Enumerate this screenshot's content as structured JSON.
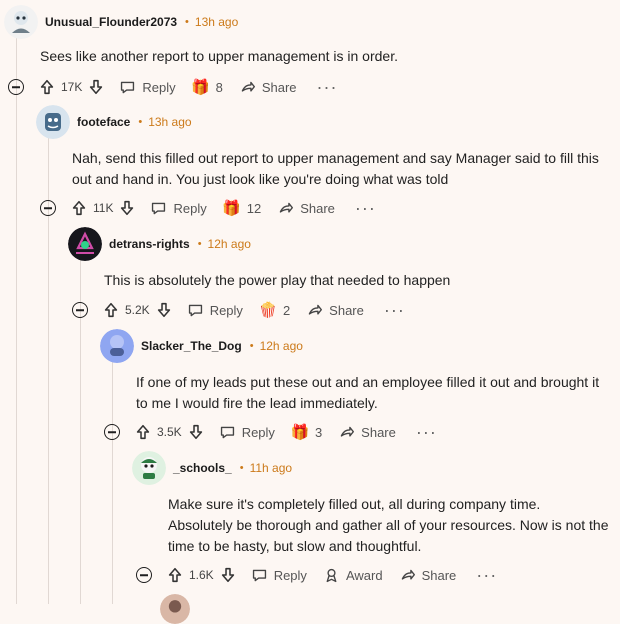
{
  "comments": [
    {
      "username": "Unusual_Flounder2073",
      "time": "13h ago",
      "dot": "•",
      "text": [
        "Sees like another report to upper management is in order."
      ],
      "votes": "17K",
      "reply": "Reply",
      "award_count": "8",
      "share": "Share",
      "more": "···",
      "award_icon": "🎁",
      "avatar_bg": "#f3f3f3",
      "avatar_fg": "#6f7f8a"
    },
    {
      "username": "footeface",
      "time": "13h ago",
      "dot": "•",
      "text": [
        "Nah, send this filled out report to upper management and say Manager said to fill this",
        "out and hand in. You just look like you're doing what was told"
      ],
      "votes": "11K",
      "reply": "Reply",
      "award_count": "12",
      "share": "Share",
      "more": "···",
      "award_icon": "🎁",
      "avatar_bg": "#dbe7ef",
      "avatar_fg": "#476b8a"
    },
    {
      "username": "detrans-rights",
      "time": "12h ago",
      "dot": "•",
      "text": [
        "This is absolutely the power play that needed to happen"
      ],
      "votes": "5.2K",
      "reply": "Reply",
      "award_count": "2",
      "share": "Share",
      "more": "···",
      "award_icon": "🍿",
      "avatar_bg": "#16161c",
      "avatar_fg": "#d04ca8"
    },
    {
      "username": "Slacker_The_Dog",
      "time": "12h ago",
      "dot": "•",
      "text": [
        "If one of my leads put these out and an employee filled it out and brought it",
        "to me I would fire the lead immediately."
      ],
      "votes": "3.5K",
      "reply": "Reply",
      "award_count": "3",
      "share": "Share",
      "more": "···",
      "award_icon": "🎁",
      "avatar_bg": "#8fa6f1",
      "avatar_fg": "#4b5f98"
    },
    {
      "username": "_schools_",
      "time": "11h ago",
      "dot": "•",
      "text": [
        "Make sure it's completely filled out, all during company time.",
        "Absolutely be thorough and gather all of your resources. Now is not the",
        "time to be hasty, but slow and thoughtful."
      ],
      "votes": "1.6K",
      "reply": "Reply",
      "award_label": "Award",
      "share": "Share",
      "more": "···",
      "avatar_bg": "#dff1e1",
      "avatar_fg": "#2d7c43"
    }
  ],
  "colors": {
    "background": "#fdf7f3",
    "meta": "#cc7a1a",
    "thread": "#e1d8d3"
  }
}
